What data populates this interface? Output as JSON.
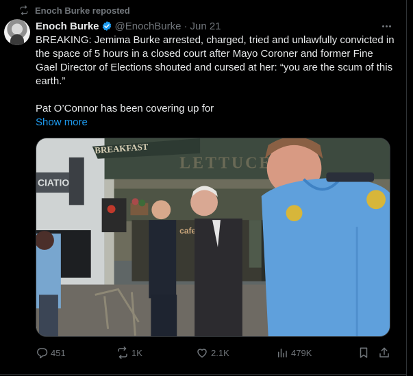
{
  "social_context": {
    "text": "Enoch Burke reposted",
    "icon": "repost-icon"
  },
  "author": {
    "name": "Enoch Burke",
    "handle": "@EnochBurke",
    "separator": "·",
    "date": "Jun 21",
    "verified_icon": "verified-badge-icon"
  },
  "tweet": {
    "text_paragraph_1": "BREAKING: Jemima Burke arrested, charged, tried and unlawfully convicted in the space of 5 hours in a closed court after Mayo Coroner and former Fine Gael Director of Elections shouted and cursed at her: “you are the scum of this earth.”",
    "text_paragraph_2": "Pat O’Connor has been covering up for",
    "show_more": "Show more"
  },
  "media": {
    "signs": {
      "top": "BREAKFAST",
      "middle": "LETTUCE EAT",
      "left": "CIATION",
      "cafe": "cafe"
    }
  },
  "actions": {
    "replies": "451",
    "reposts": "1K",
    "likes": "2.1K",
    "views": "479K"
  },
  "colors": {
    "background": "#000000",
    "text": "#e7e9ea",
    "muted": "#71767b",
    "link": "#1d9bf0",
    "verified": "#1d9bf0",
    "border": "#2f3336"
  }
}
